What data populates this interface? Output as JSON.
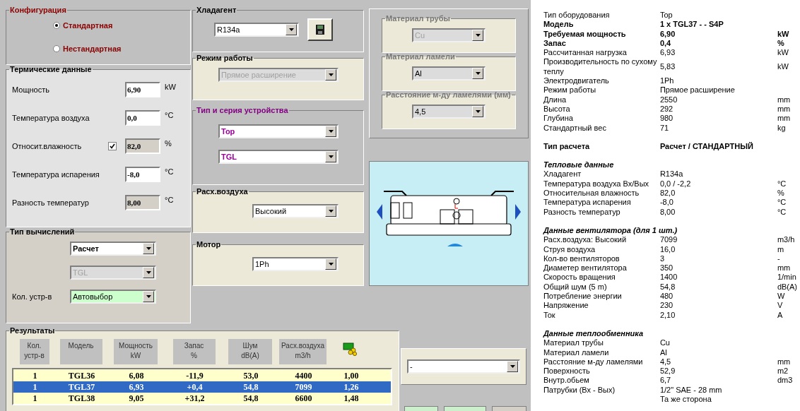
{
  "configuration": {
    "title": "Конфигурация",
    "options": [
      {
        "label": "Стандартная",
        "selected": true
      },
      {
        "label": "Нестандартная",
        "selected": false
      }
    ]
  },
  "thermal_data": {
    "title": "Термические данные",
    "rows": [
      {
        "label": "Мощность",
        "value": "6,90",
        "unit": "kW",
        "editable": true
      },
      {
        "label": "Температура воздуха",
        "value": "0,0",
        "unit": "°C",
        "editable": true
      },
      {
        "label": "Относит.влажность",
        "value": "82,0",
        "unit": "%",
        "editable": false,
        "checkbox": {
          "checked": true
        }
      },
      {
        "label": "Температура испарения",
        "value": "-8,0",
        "unit": "°C",
        "editable": true
      },
      {
        "label": "Разность температур",
        "value": "8,00",
        "unit": "°C",
        "editable": false
      }
    ]
  },
  "calculation_type": {
    "title": "Тип вычислений",
    "selects": [
      {
        "value": "Расчет",
        "disabled": false,
        "highlighted": false
      },
      {
        "value": "TGL",
        "disabled": true,
        "highlighted": false
      },
      {
        "label": "Кол. устр-в",
        "value": "Автовыбор",
        "disabled": false,
        "highlighted": true
      }
    ]
  },
  "refrigerant": {
    "title": "Хладагент",
    "value": "R134a",
    "disabled": false
  },
  "operating_mode": {
    "title": "Режим работы",
    "value": "Прямое расширение",
    "disabled": true
  },
  "unit_type": {
    "title": "Тип и серия устройства",
    "selects": [
      {
        "value": "Top",
        "disabled": false
      },
      {
        "value": "TGL",
        "disabled": false
      }
    ]
  },
  "airflow": {
    "title": "Расх.воздуха",
    "value": "Высокий",
    "disabled": false
  },
  "motor": {
    "title": "Мотор",
    "value": "1Ph",
    "disabled": false
  },
  "coil": [
    {
      "title": "Материал трубы",
      "value": "Cu",
      "disabled": true
    },
    {
      "title": "Материал ламели",
      "value": "Al",
      "disabled": false
    },
    {
      "title": "Расстояние м-ду ламелями (мм)",
      "value": "4,5",
      "disabled": false
    }
  ],
  "results": {
    "title": "Результаты",
    "columns": [
      {
        "lines": [
          "Кол.",
          "устр-в"
        ]
      },
      {
        "lines": [
          "Модель"
        ]
      },
      {
        "lines": [
          "Мощность",
          "kW"
        ]
      },
      {
        "lines": [
          "Запас",
          "%"
        ]
      },
      {
        "lines": [
          "Шум",
          "dB(A)"
        ]
      },
      {
        "lines": [
          "Расх.воздуха",
          "m3/h"
        ]
      }
    ],
    "rows": [
      {
        "cells": [
          "1",
          "TGL36",
          "6,08",
          "-11,9",
          "53,0",
          "4400",
          "1,00"
        ],
        "selected": false
      },
      {
        "cells": [
          "1",
          "TGL37",
          "6,93",
          "+0,4",
          "54,8",
          "7099",
          "1,26"
        ],
        "selected": true
      },
      {
        "cells": [
          "1",
          "TGL38",
          "9,05",
          "+31,2",
          "54,8",
          "6600",
          "1,48"
        ],
        "selected": false
      }
    ]
  },
  "extra_select": {
    "value": "-",
    "disabled": false
  },
  "report": {
    "sections": [
      {
        "rows": [
          {
            "label": "Тип оборудования",
            "value": "Top",
            "bold": false
          },
          {
            "label": "Модель",
            "value": "1 x TGL37 - - S4P",
            "bold": true
          },
          {
            "label": "Требуемая мощность",
            "value": "6,90",
            "unit": "kW",
            "bold": true
          },
          {
            "label": "Запас",
            "value": "0,4",
            "unit": "%",
            "bold": true
          },
          {
            "label": "Рассчитанная нагрузка",
            "value": "6,93",
            "unit": "kW",
            "bold": false
          },
          {
            "label": "Производительность по сухому теплу",
            "value": "5,83",
            "unit": "kW",
            "bold": false
          },
          {
            "label": "Электродвигатель",
            "value": "1Ph",
            "bold": false
          },
          {
            "label": "Режим работы",
            "value": "Прямое расширение",
            "bold": false
          },
          {
            "label": "Длина",
            "value": "2550",
            "unit": "mm",
            "bold": false
          },
          {
            "label": "Высота",
            "value": "292",
            "unit": "mm",
            "bold": false
          },
          {
            "label": "Глубина",
            "value": "980",
            "unit": "mm",
            "bold": false
          },
          {
            "label": "Стандартный вес",
            "value": "71",
            "unit": "kg",
            "bold": false
          }
        ]
      },
      {
        "rows": [
          {
            "label": "Тип расчета",
            "value": "Расчет / СТАНДАРТНЫЙ",
            "bold": true
          }
        ]
      },
      {
        "heading": "Тепловые данные",
        "rows": [
          {
            "label": "Хладагент",
            "value": "R134a",
            "bold": false
          },
          {
            "label": "Температура воздуха Вх/Вых",
            "value": "0,0 / -2,2",
            "unit": "°C",
            "bold": false
          },
          {
            "label": "Относительная влажность",
            "value": "82,0",
            "unit": "%",
            "bold": false
          },
          {
            "label": "Температура испарения",
            "value": "-8,0",
            "unit": "°C",
            "bold": false
          },
          {
            "label": "Разность температур",
            "value": "8,00",
            "unit": "°C",
            "bold": false
          }
        ]
      },
      {
        "heading": "Данные вентилятора (для 1 шт.)",
        "rows": [
          {
            "label": "Расх.воздуха: Высокий",
            "value": "7099",
            "unit": "m3/h",
            "bold": false
          },
          {
            "label": "Струя воздуха",
            "value": "16,0",
            "unit": "m",
            "bold": false
          },
          {
            "label": "Кол-во вентиляторов",
            "value": "3",
            "unit": "-",
            "bold": false
          },
          {
            "label": "Диаметер вентилятора",
            "value": "350",
            "unit": "mm",
            "bold": false
          },
          {
            "label": "Скорость вращения",
            "value": "1400",
            "unit": "1/min",
            "bold": false
          },
          {
            "label": "Общий шум (5 m)",
            "value": "54,8",
            "unit": "dB(A)",
            "bold": false
          },
          {
            "label": "Потребление энергии",
            "value": "480",
            "unit": "W",
            "bold": false
          },
          {
            "label": "Напряжение",
            "value": "230",
            "unit": "V",
            "bold": false
          },
          {
            "label": "Ток",
            "value": "2,10",
            "unit": "A",
            "bold": false
          }
        ]
      },
      {
        "heading": "Данные теплообменника",
        "rows": [
          {
            "label": "Материал трубы",
            "value": "Cu",
            "bold": false
          },
          {
            "label": "Материал ламели",
            "value": "Al",
            "bold": false
          },
          {
            "label": "Расстояние м-ду ламелями",
            "value": "4,5",
            "unit": "mm",
            "bold": false
          },
          {
            "label": "Поверхность",
            "value": "52,9",
            "unit": "m2",
            "bold": false
          },
          {
            "label": "Внутр.обьем",
            "value": "6,7",
            "unit": "dm3",
            "bold": false
          },
          {
            "label": "Патрубки (Вх - Вых)",
            "value": "1/2\" SAE - 28 mm",
            "bold": false
          },
          {
            "value": "Та же сторона",
            "bold": false
          }
        ]
      }
    ]
  }
}
